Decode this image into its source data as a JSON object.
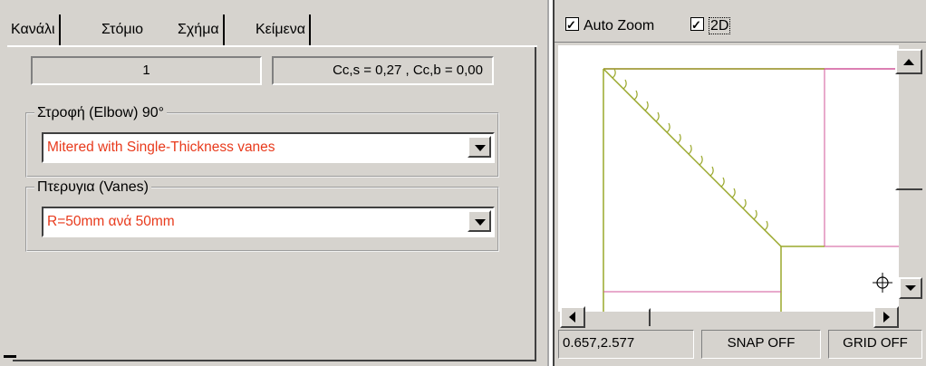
{
  "tabs": [
    {
      "label": "Κανάλι"
    },
    {
      "label": "Στόμιο"
    },
    {
      "label": "Σχήμα"
    },
    {
      "label": "Κείμενα"
    }
  ],
  "info": {
    "index": "1",
    "coefficients": "Cc,s = 0,27 , Cc,b = 0,00"
  },
  "elbow": {
    "group_label": "Στροφή (Elbow) 90°",
    "selected": "Mitered with Single-Thickness vanes"
  },
  "vanes": {
    "group_label": "Πτερυγια (Vanes)",
    "selected": "R=50mm ανά 50mm"
  },
  "toolbar": {
    "auto_zoom": {
      "label": "Auto Zoom",
      "checked": true
    },
    "two_d": {
      "label": "2D",
      "checked": true
    }
  },
  "statusbar": {
    "coords": "0.657,2.577",
    "snap": "SNAP OFF",
    "grid": "GRID OFF"
  },
  "colors": {
    "duct_outline": "#9aa82c",
    "duct_aux": "#d1559a",
    "combo_text": "#e83a1c"
  },
  "icons": {
    "crosshair": "crosshair-icon",
    "scroll_up": "arrow-up-icon",
    "scroll_down": "arrow-down-icon",
    "scroll_left": "arrow-left-icon",
    "scroll_right": "arrow-right-icon"
  }
}
